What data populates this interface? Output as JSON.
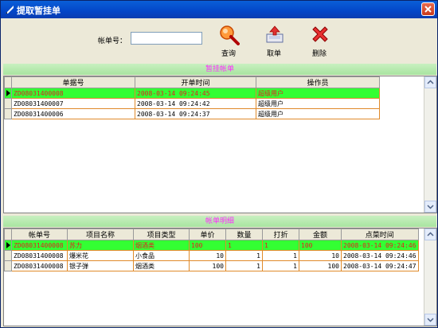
{
  "window": {
    "title": "提取暂挂单"
  },
  "toolbar": {
    "account_label": "帐单号：",
    "account_value": "",
    "query_label": "查询",
    "fetch_label": "取单",
    "delete_label": "删除"
  },
  "pending": {
    "header": "暂挂帐单",
    "columns": [
      "单据号",
      "开单时间",
      "操作员"
    ],
    "rows": [
      [
        "ZD08031400008",
        "2008-03-14 09:24:45",
        "超级用户"
      ],
      [
        "ZD08031400007",
        "2008-03-14 09:24:42",
        "超级用户"
      ],
      [
        "ZD08031400006",
        "2008-03-14 09:24:37",
        "超级用户"
      ]
    ]
  },
  "details": {
    "header": "帐单明细",
    "columns": [
      "帐单号",
      "项目名称",
      "项目类型",
      "单价",
      "数量",
      "打折",
      "金额",
      "点菜时间"
    ],
    "rows": [
      [
        "ZD08031400008",
        "苏力",
        "烟酒类",
        "100",
        "1",
        "1",
        "100",
        "2008-03-14 09:24:46"
      ],
      [
        "ZD08031400008",
        "爆米花",
        "小食品",
        "10",
        "1",
        "1",
        "10",
        "2008-03-14 09:24:46"
      ],
      [
        "ZD08031400008",
        "银子弹",
        "烟酒类",
        "100",
        "1",
        "1",
        "100",
        "2008-03-14 09:24:47"
      ]
    ]
  },
  "colors": {
    "titlebar": "#0a5fd8",
    "selected_row": "#33ff33",
    "selected_text": "#e02020",
    "section_header_text": "#ff2aff"
  }
}
